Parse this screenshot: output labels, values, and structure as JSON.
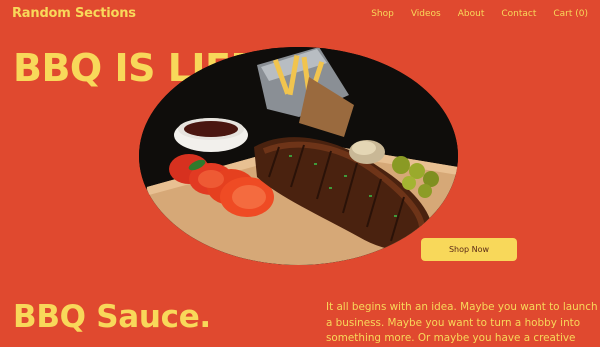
{
  "brand": "Random Sections",
  "nav": {
    "items": [
      "Shop",
      "Videos",
      "About",
      "Contact",
      "Cart (0)"
    ]
  },
  "hero": {
    "title": "BBQ IS LIFE",
    "image_alt": "Barbecue ribs on a wooden board with sliced tomatoes, dipping sauce, fries and grilled vegetables",
    "cta_label": "Shop Now"
  },
  "section": {
    "title": "BBQ Sauce.",
    "body": "It all begins with an idea. Maybe you want to launch a business. Maybe you want to turn a hobby into something more. Or maybe you have a creative"
  },
  "colors": {
    "background": "#E0492F",
    "accent": "#F8D85A"
  }
}
